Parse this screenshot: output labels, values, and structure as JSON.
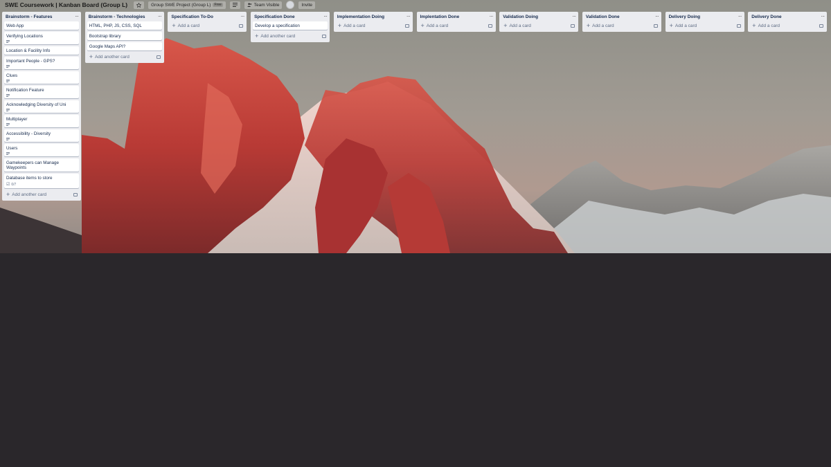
{
  "header": {
    "board_title": "SWE Coursework | Kanban Board (Group L)",
    "team_label": "Group SWE Project (Group L)",
    "team_badge": "Free",
    "visibility_label": "Team Visible",
    "invite_label": "Invite"
  },
  "lists": [
    {
      "title": "Brainstorm - Features",
      "cards": [
        {
          "text": "Web App",
          "desc": false
        },
        {
          "text": "Verifying Locations",
          "desc": true
        },
        {
          "text": "Location & Facility Info",
          "desc": false
        },
        {
          "text": "Important People - GPS?",
          "desc": true
        },
        {
          "text": "Clues",
          "desc": true
        },
        {
          "text": "Notification Feature",
          "desc": true
        },
        {
          "text": "Acknowledging Diversity of Uni",
          "desc": true
        },
        {
          "text": "Multiplayer",
          "desc": true
        },
        {
          "text": "Accessibility - Diversity",
          "desc": true
        },
        {
          "text": "Users",
          "desc": true
        },
        {
          "text": "Gamekeepers can Manage Waypoints",
          "desc": false
        },
        {
          "text": "Database items to store",
          "desc": false,
          "checklist": "0/7"
        }
      ],
      "add_label": "Add another card"
    },
    {
      "title": "Brainstorm - Technologies",
      "cards": [
        {
          "text": "HTML, PHP, JS, CSS, SQL",
          "desc": false
        },
        {
          "text": "Bootstrap library",
          "desc": false
        },
        {
          "text": "Google Maps API?",
          "desc": false
        }
      ],
      "add_label": "Add another card"
    },
    {
      "title": "Specification To-Do",
      "cards": [],
      "add_label": "Add a card"
    },
    {
      "title": "Specification Done",
      "cards": [
        {
          "text": "Develop a specification",
          "desc": false
        }
      ],
      "add_label": "Add another card"
    },
    {
      "title": "Implementation Doing",
      "cards": [],
      "add_label": "Add a card"
    },
    {
      "title": "Implentation Done",
      "cards": [],
      "add_label": "Add a card"
    },
    {
      "title": "Validation Doing",
      "cards": [],
      "add_label": "Add a card"
    },
    {
      "title": "Validation Done",
      "cards": [],
      "add_label": "Add a card"
    },
    {
      "title": "Delivery Doing",
      "cards": [],
      "add_label": "Add a card"
    },
    {
      "title": "Delivery Done",
      "cards": [],
      "add_label": "Add a card"
    }
  ],
  "colors": {
    "list_bg": "#ebecf0",
    "card_bg": "#ffffff",
    "page_bg": "#2a272b",
    "text": "#172b4d",
    "muted": "#5e6c84"
  },
  "icons": [
    "star-icon",
    "menu-icon",
    "team-icon",
    "avatar",
    "ellipsis-icon",
    "plus-icon",
    "card-template-icon",
    "description-icon",
    "checklist-icon"
  ]
}
